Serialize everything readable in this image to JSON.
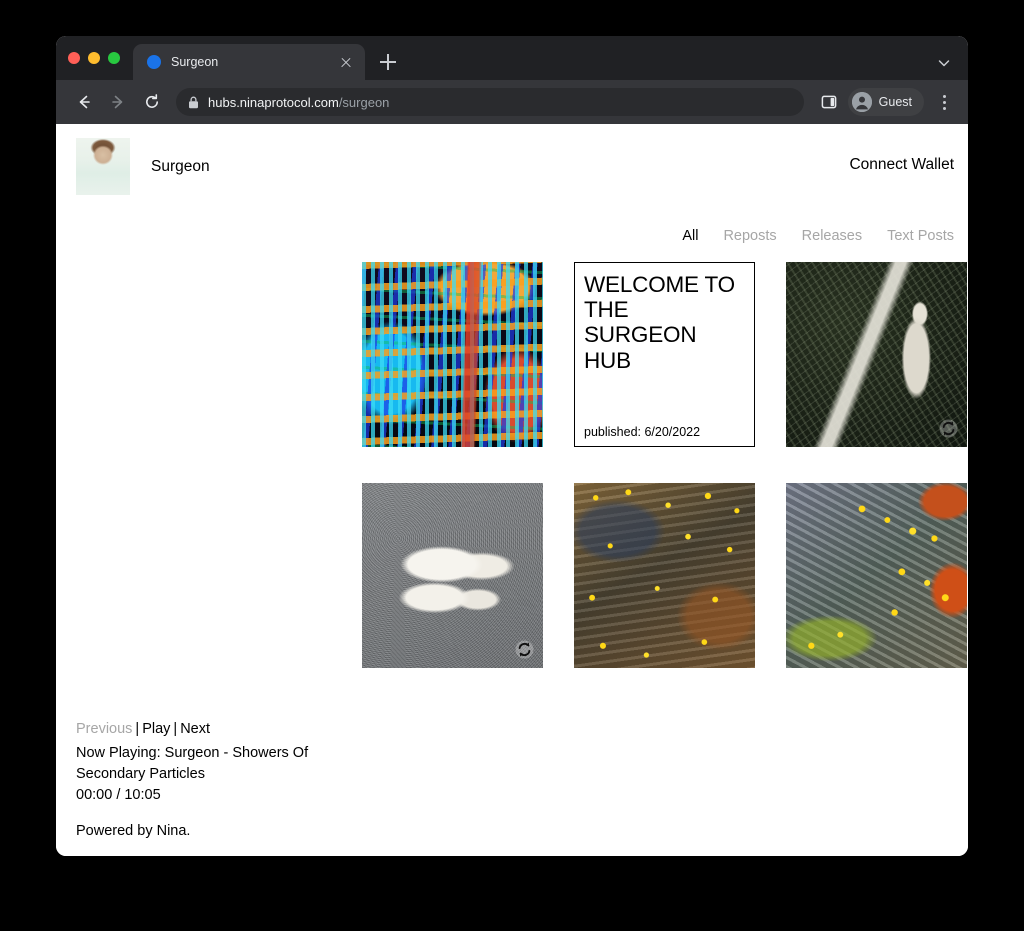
{
  "browser": {
    "tab": {
      "title": "Surgeon",
      "favicon": "globe-icon",
      "close": "close-icon"
    },
    "new_tab_label": "+",
    "tabstrip_chevron": "chevron-down-icon",
    "toolbar": {
      "back": "back-arrow-icon",
      "forward": "forward-arrow-icon",
      "reload": "reload-icon",
      "lock": "lock-icon",
      "url_domain": "hubs.ninaprotocol.com",
      "url_path": "/surgeon",
      "side_panel": "side-panel-icon",
      "profile_name": "Guest",
      "profile_avatar": "account-circle-icon",
      "menu": "three-dot-menu-icon"
    }
  },
  "page": {
    "header": {
      "avatar": "hub-avatar",
      "hub_name": "Surgeon",
      "connect_wallet": "Connect Wallet"
    },
    "filters": [
      {
        "label": "All",
        "active": true
      },
      {
        "label": "Reposts",
        "active": false
      },
      {
        "label": "Releases",
        "active": false
      },
      {
        "label": "Text Posts",
        "active": false
      }
    ],
    "grid": [
      {
        "type": "release",
        "art": "art-glitch",
        "reposted": false
      },
      {
        "type": "text-post",
        "title": "WELCOME TO THE SURGEON HUB",
        "meta": "published: 6/20/2022",
        "reposted": false
      },
      {
        "type": "release",
        "art": "art-bone",
        "reposted": true
      },
      {
        "type": "release",
        "art": "art-fur",
        "reposted": true
      },
      {
        "type": "release",
        "art": "art-speckle-a",
        "reposted": false
      },
      {
        "type": "release",
        "art": "art-speckle-b",
        "reposted": false
      }
    ],
    "player": {
      "previous": "Previous",
      "play": "Play",
      "next": "Next",
      "separator": "|",
      "now_playing": "Now Playing: Surgeon - Showers Of Secondary Particles",
      "time": "00:00 / 10:05",
      "powered_by": "Powered by Nina."
    }
  },
  "colors": {
    "tabstrip": "#202124",
    "toolbar": "#35363a",
    "omnibox": "#2a2b2e",
    "favicon_blue": "#1a73e8",
    "page_bg": "#ffffff",
    "text_primary": "#000000",
    "text_muted": "#a6a6a6",
    "desktop": "#000000"
  }
}
